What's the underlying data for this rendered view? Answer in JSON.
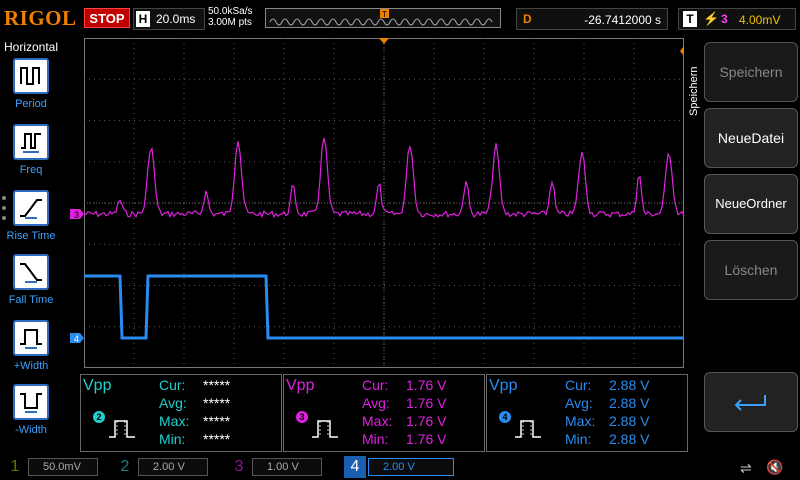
{
  "topbar": {
    "brand": "RIGOL",
    "run_state": "STOP",
    "timebase_label": "H",
    "timebase_value": "20.0ms",
    "sample_rate": "50.0kSa/s",
    "memory_depth": "3.00M pts",
    "trigger_pos_marker": "T",
    "delay_label": "D",
    "delay_value": "-26.7412000 s",
    "trigger_label": "T",
    "trigger_source": "3",
    "trigger_level": "4.00mV",
    "trigger_icon": "trigger-edge-icon"
  },
  "left_menu": {
    "title": "Horizontal",
    "items": [
      {
        "label": "Period",
        "icon": "period-icon"
      },
      {
        "label": "Freq",
        "icon": "frequency-icon"
      },
      {
        "label": "Rise Time",
        "icon": "rise-time-icon"
      },
      {
        "label": "Fall Time",
        "icon": "fall-time-icon"
      },
      {
        "label": "+Width",
        "icon": "positive-width-icon"
      },
      {
        "label": "-Width",
        "icon": "negative-width-icon"
      }
    ]
  },
  "right_menu": {
    "title": "Speichern",
    "buttons": [
      {
        "label": "Speichern",
        "enabled": false
      },
      {
        "label": "NeueDatei",
        "enabled": true
      },
      {
        "label": "NeueOrdner",
        "enabled": true
      },
      {
        "label": "Löschen",
        "enabled": false
      },
      {
        "label": "",
        "icon": "enter-arrow-icon",
        "enabled": true
      }
    ]
  },
  "waveforms": {
    "ch3": {
      "marker": "3",
      "color": "#e020e0"
    },
    "ch4": {
      "marker": "4",
      "color": "#2a8cf0"
    },
    "trigger_level_marker": "T"
  },
  "measurements": [
    {
      "type": "Vpp",
      "channel": "2",
      "color": "#20d0d0",
      "cur": "*****",
      "avg": "*****",
      "max": "*****",
      "min": "*****"
    },
    {
      "type": "Vpp",
      "channel": "3",
      "color": "#e020e0",
      "cur": "1.76 V",
      "avg": "1.76 V",
      "max": "1.76 V",
      "min": "1.76 V"
    },
    {
      "type": "Vpp",
      "channel": "4",
      "color": "#2a8cf0",
      "cur": "2.88 V",
      "avg": "2.88 V",
      "max": "2.88 V",
      "min": "2.88 V"
    }
  ],
  "measure_labels": {
    "cur": "Cur:",
    "avg": "Avg:",
    "max": "Max:",
    "min": "Min:"
  },
  "channels": [
    {
      "num": "1",
      "scale": "50.0mV",
      "color": "#d0d000",
      "active": false
    },
    {
      "num": "2",
      "scale": "2.00 V",
      "color": "#20d0d0",
      "active": false
    },
    {
      "num": "3",
      "scale": "1.00 V",
      "color": "#e020e0",
      "active": false
    },
    {
      "num": "4",
      "scale": "2.00 V",
      "color": "#2a8cf0",
      "active": true
    }
  ],
  "status_icons": {
    "usb": "usb-icon",
    "speaker": "speaker-muted-icon"
  }
}
